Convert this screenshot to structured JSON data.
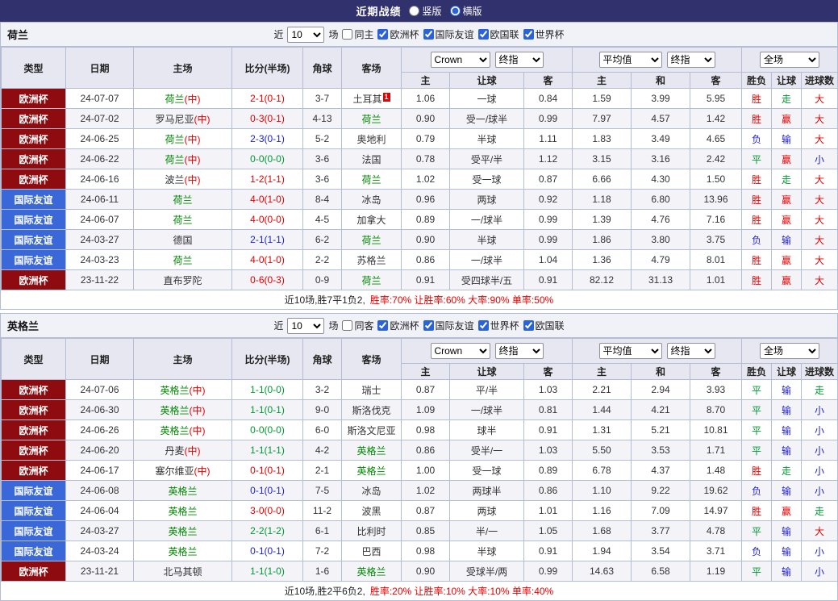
{
  "colors": {
    "topbar_bg": "#31316d",
    "border": "#b4bdd4",
    "header_bg": "#e7e7f1",
    "filter_bg": "#f1f1f8",
    "row_alt_bg": "#f3f3f8",
    "euro_badge": "#8e0b10",
    "friendly_badge": "#3a68d8",
    "featured_team": "#008800",
    "neutral_mark": "#e60000",
    "win_red": "#e60000",
    "draw_green": "#009933",
    "loss_blue": "#2222cc",
    "stats_red": "#e60000"
  },
  "topbar": {
    "title": "近期战绩",
    "radios": [
      {
        "label": "竖版",
        "selected": false
      },
      {
        "label": "横版",
        "selected": true
      }
    ]
  },
  "sections": [
    {
      "team": "荷兰",
      "filter": {
        "near_label": "近",
        "count": "10",
        "games_label": "场",
        "checkboxes": [
          {
            "label": "同主",
            "checked": false
          },
          {
            "label": "欧洲杯",
            "checked": true
          },
          {
            "label": "国际友谊",
            "checked": true
          },
          {
            "label": "欧国联",
            "checked": true
          },
          {
            "label": "世界杯",
            "checked": true
          }
        ]
      },
      "header": {
        "col_labels": [
          "类型",
          "日期",
          "主场",
          "比分(半场)",
          "角球",
          "客场"
        ],
        "bookmaker_select": "Crown",
        "index_select1": "终指",
        "avg_select": "平均值",
        "index_select2": "终指",
        "scope_select": "全场",
        "sub_labels": [
          "主",
          "让球",
          "客",
          "主",
          "和",
          "客",
          "胜负",
          "让球",
          "进球数"
        ]
      },
      "rows": [
        {
          "type": "欧洲杯",
          "date": "24-07-07",
          "home": "荷兰(中)",
          "score": "2-1(0-1)",
          "corners": "3-7",
          "away": "土耳其",
          "away_red_card": "1",
          "odds_home": "1.06",
          "handicap": "一球",
          "odds_away": "0.84",
          "avg_home": "1.59",
          "avg_draw": "3.99",
          "avg_away": "5.95",
          "result": "胜",
          "handicap_result": "走",
          "goals": "大"
        },
        {
          "type": "欧洲杯",
          "date": "24-07-02",
          "home": "罗马尼亚(中)",
          "score": "0-3(0-1)",
          "corners": "4-13",
          "away": "荷兰",
          "odds_home": "0.90",
          "handicap": "受一/球半",
          "odds_away": "0.99",
          "avg_home": "7.97",
          "avg_draw": "4.57",
          "avg_away": "1.42",
          "result": "胜",
          "handicap_result": "赢",
          "goals": "大"
        },
        {
          "type": "欧洲杯",
          "date": "24-06-25",
          "home": "荷兰(中)",
          "score": "2-3(0-1)",
          "corners": "5-2",
          "away": "奥地利",
          "odds_home": "0.79",
          "handicap": "半球",
          "odds_away": "1.11",
          "avg_home": "1.83",
          "avg_draw": "3.49",
          "avg_away": "4.65",
          "result": "负",
          "handicap_result": "输",
          "goals": "大"
        },
        {
          "type": "欧洲杯",
          "date": "24-06-22",
          "home": "荷兰(中)",
          "score": "0-0(0-0)",
          "corners": "3-6",
          "away": "法国",
          "odds_home": "0.78",
          "handicap": "受平/半",
          "odds_away": "1.12",
          "avg_home": "3.15",
          "avg_draw": "3.16",
          "avg_away": "2.42",
          "result": "平",
          "handicap_result": "赢",
          "goals": "小"
        },
        {
          "type": "欧洲杯",
          "date": "24-06-16",
          "home": "波兰(中)",
          "score": "1-2(1-1)",
          "corners": "3-6",
          "away": "荷兰",
          "odds_home": "1.02",
          "handicap": "受一球",
          "odds_away": "0.87",
          "avg_home": "6.66",
          "avg_draw": "4.30",
          "avg_away": "1.50",
          "result": "胜",
          "handicap_result": "走",
          "goals": "大"
        },
        {
          "type": "国际友谊",
          "date": "24-06-11",
          "home": "荷兰",
          "score": "4-0(1-0)",
          "corners": "8-4",
          "away": "冰岛",
          "odds_home": "0.96",
          "handicap": "两球",
          "odds_away": "0.92",
          "avg_home": "1.18",
          "avg_draw": "6.80",
          "avg_away": "13.96",
          "result": "胜",
          "handicap_result": "赢",
          "goals": "大"
        },
        {
          "type": "国际友谊",
          "date": "24-06-07",
          "home": "荷兰",
          "score": "4-0(0-0)",
          "corners": "4-5",
          "away": "加拿大",
          "odds_home": "0.89",
          "handicap": "一/球半",
          "odds_away": "0.99",
          "avg_home": "1.39",
          "avg_draw": "4.76",
          "avg_away": "7.16",
          "result": "胜",
          "handicap_result": "赢",
          "goals": "大"
        },
        {
          "type": "国际友谊",
          "date": "24-03-27",
          "home": "德国",
          "score": "2-1(1-1)",
          "corners": "6-2",
          "away": "荷兰",
          "odds_home": "0.90",
          "handicap": "半球",
          "odds_away": "0.99",
          "avg_home": "1.86",
          "avg_draw": "3.80",
          "avg_away": "3.75",
          "result": "负",
          "handicap_result": "输",
          "goals": "大"
        },
        {
          "type": "国际友谊",
          "date": "24-03-23",
          "home": "荷兰",
          "score": "4-0(1-0)",
          "corners": "2-2",
          "away": "苏格兰",
          "odds_home": "0.86",
          "handicap": "一/球半",
          "odds_away": "1.04",
          "avg_home": "1.36",
          "avg_draw": "4.79",
          "avg_away": "8.01",
          "result": "胜",
          "handicap_result": "赢",
          "goals": "大"
        },
        {
          "type": "欧洲杯",
          "date": "23-11-22",
          "home": "直布罗陀",
          "score": "0-6(0-3)",
          "corners": "0-9",
          "away": "荷兰",
          "odds_home": "0.91",
          "handicap": "受四球半/五",
          "odds_away": "0.91",
          "avg_home": "82.12",
          "avg_draw": "31.13",
          "avg_away": "1.01",
          "result": "胜",
          "handicap_result": "赢",
          "goals": "大"
        }
      ],
      "footer": {
        "summary": "近10场,胜7平1负2,",
        "stats": "胜率:70% 让胜率:60% 大率:90% 单率:50%"
      }
    },
    {
      "team": "英格兰",
      "filter": {
        "near_label": "近",
        "count": "10",
        "games_label": "场",
        "checkboxes": [
          {
            "label": "同客",
            "checked": false
          },
          {
            "label": "欧洲杯",
            "checked": true
          },
          {
            "label": "国际友谊",
            "checked": true
          },
          {
            "label": "世界杯",
            "checked": true
          },
          {
            "label": "欧国联",
            "checked": true
          }
        ]
      },
      "header": {
        "col_labels": [
          "类型",
          "日期",
          "主场",
          "比分(半场)",
          "角球",
          "客场"
        ],
        "bookmaker_select": "Crown",
        "index_select1": "终指",
        "avg_select": "平均值",
        "index_select2": "终指",
        "scope_select": "全场",
        "sub_labels": [
          "主",
          "让球",
          "客",
          "主",
          "和",
          "客",
          "胜负",
          "让球",
          "进球数"
        ]
      },
      "rows": [
        {
          "type": "欧洲杯",
          "date": "24-07-06",
          "home": "英格兰(中)",
          "score": "1-1(0-0)",
          "corners": "3-2",
          "away": "瑞士",
          "odds_home": "0.87",
          "handicap": "平/半",
          "odds_away": "1.03",
          "avg_home": "2.21",
          "avg_draw": "2.94",
          "avg_away": "3.93",
          "result": "平",
          "handicap_result": "输",
          "goals": "走"
        },
        {
          "type": "欧洲杯",
          "date": "24-06-30",
          "home": "英格兰(中)",
          "score": "1-1(0-1)",
          "corners": "9-0",
          "away": "斯洛伐克",
          "odds_home": "1.09",
          "handicap": "一/球半",
          "odds_away": "0.81",
          "avg_home": "1.44",
          "avg_draw": "4.21",
          "avg_away": "8.70",
          "result": "平",
          "handicap_result": "输",
          "goals": "小"
        },
        {
          "type": "欧洲杯",
          "date": "24-06-26",
          "home": "英格兰(中)",
          "score": "0-0(0-0)",
          "corners": "6-0",
          "away": "斯洛文尼亚",
          "odds_home": "0.98",
          "handicap": "球半",
          "odds_away": "0.91",
          "avg_home": "1.31",
          "avg_draw": "5.21",
          "avg_away": "10.81",
          "result": "平",
          "handicap_result": "输",
          "goals": "小"
        },
        {
          "type": "欧洲杯",
          "date": "24-06-20",
          "home": "丹麦(中)",
          "score": "1-1(1-1)",
          "corners": "4-2",
          "away": "英格兰",
          "odds_home": "0.86",
          "handicap": "受半/一",
          "odds_away": "1.03",
          "avg_home": "5.50",
          "avg_draw": "3.53",
          "avg_away": "1.71",
          "result": "平",
          "handicap_result": "输",
          "goals": "小"
        },
        {
          "type": "欧洲杯",
          "date": "24-06-17",
          "home": "塞尔维亚(中)",
          "score": "0-1(0-1)",
          "corners": "2-1",
          "away": "英格兰",
          "odds_home": "1.00",
          "handicap": "受一球",
          "odds_away": "0.89",
          "avg_home": "6.78",
          "avg_draw": "4.37",
          "avg_away": "1.48",
          "result": "胜",
          "handicap_result": "走",
          "goals": "小"
        },
        {
          "type": "国际友谊",
          "date": "24-06-08",
          "home": "英格兰",
          "score": "0-1(0-1)",
          "corners": "7-5",
          "away": "冰岛",
          "odds_home": "1.02",
          "handicap": "两球半",
          "odds_away": "0.86",
          "avg_home": "1.10",
          "avg_draw": "9.22",
          "avg_away": "19.62",
          "result": "负",
          "handicap_result": "输",
          "goals": "小"
        },
        {
          "type": "国际友谊",
          "date": "24-06-04",
          "home": "英格兰",
          "score": "3-0(0-0)",
          "corners": "11-2",
          "away": "波黑",
          "odds_home": "0.87",
          "handicap": "两球",
          "odds_away": "1.01",
          "avg_home": "1.16",
          "avg_draw": "7.09",
          "avg_away": "14.97",
          "result": "胜",
          "handicap_result": "赢",
          "goals": "走"
        },
        {
          "type": "国际友谊",
          "date": "24-03-27",
          "home": "英格兰",
          "score": "2-2(1-2)",
          "corners": "6-1",
          "away": "比利时",
          "odds_home": "0.85",
          "handicap": "半/一",
          "odds_away": "1.05",
          "avg_home": "1.68",
          "avg_draw": "3.77",
          "avg_away": "4.78",
          "result": "平",
          "handicap_result": "输",
          "goals": "大"
        },
        {
          "type": "国际友谊",
          "date": "24-03-24",
          "home": "英格兰",
          "score": "0-1(0-1)",
          "corners": "7-2",
          "away": "巴西",
          "odds_home": "0.98",
          "handicap": "半球",
          "odds_away": "0.91",
          "avg_home": "1.94",
          "avg_draw": "3.54",
          "avg_away": "3.71",
          "result": "负",
          "handicap_result": "输",
          "goals": "小"
        },
        {
          "type": "欧洲杯",
          "date": "23-11-21",
          "home": "北马其顿",
          "score": "1-1(1-0)",
          "corners": "1-6",
          "away": "英格兰",
          "odds_home": "0.90",
          "handicap": "受球半/两",
          "odds_away": "0.99",
          "avg_home": "14.63",
          "avg_draw": "6.58",
          "avg_away": "1.19",
          "result": "平",
          "handicap_result": "输",
          "goals": "小"
        }
      ],
      "footer": {
        "summary": "近10场,胜2平6负2,",
        "stats": "胜率:20% 让胜率:10% 大率:10% 单率:40%"
      }
    }
  ]
}
